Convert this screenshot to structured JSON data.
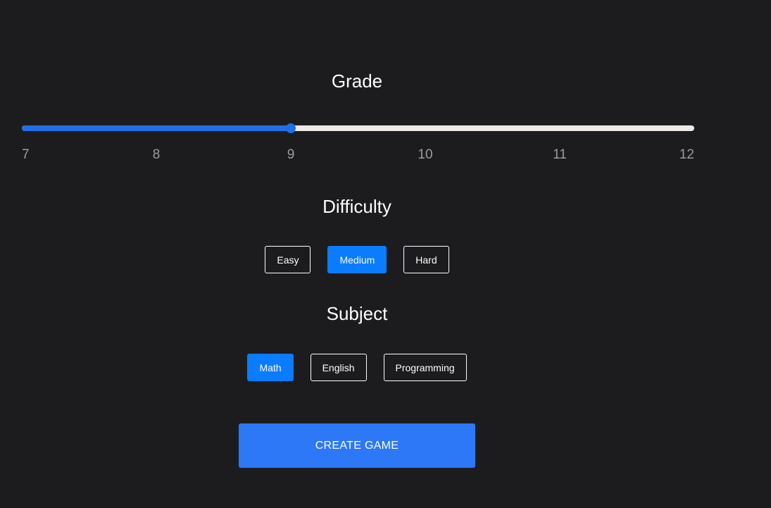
{
  "grade": {
    "title": "Grade",
    "min": 7,
    "max": 12,
    "value": 9,
    "marks": [
      "7",
      "8",
      "9",
      "10",
      "11",
      "12"
    ]
  },
  "difficulty": {
    "title": "Difficulty",
    "options": [
      "Easy",
      "Medium",
      "Hard"
    ],
    "selected": "Medium"
  },
  "subject": {
    "title": "Subject",
    "options": [
      "Math",
      "English",
      "Programming"
    ],
    "selected": "Math"
  },
  "actions": {
    "create_label": "CREATE GAME"
  },
  "colors": {
    "background": "#1c1c1e",
    "accent": "#0a7cff",
    "slider_track": "#1f6fe6",
    "slider_rail": "#ece9e6",
    "create_button": "#2c78f6"
  }
}
